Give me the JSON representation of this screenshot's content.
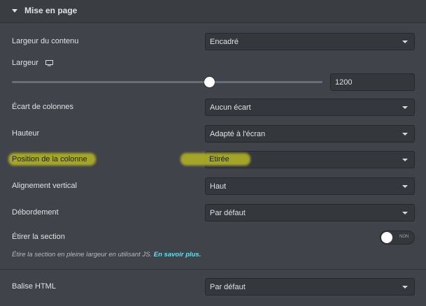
{
  "section": {
    "title": "Mise en page",
    "icon": "caret-down-icon"
  },
  "controls": {
    "content_width": {
      "label": "Largeur du contenu",
      "value": "Encadré"
    },
    "width": {
      "label": "Largeur",
      "icon": "desktop-icon",
      "value": "1200"
    },
    "column_gap": {
      "label": "Écart de colonnes",
      "value": "Aucun écart"
    },
    "height": {
      "label": "Hauteur",
      "value": "Adapté à l'écran"
    },
    "column_position": {
      "label": "Position de la colonne",
      "value": "Etirée"
    },
    "vertical_align": {
      "label": "Alignement vertical",
      "value": "Haut"
    },
    "overflow": {
      "label": "Débordement",
      "value": "Par défaut"
    },
    "stretch_section": {
      "label": "Étirer la section",
      "toggle_text": "NON",
      "help_text": "Étire la section en pleine largeur en utilisant JS.",
      "help_link": "En savoir plus."
    },
    "html_tag": {
      "label": "Balise HTML",
      "value": "Par défaut"
    }
  },
  "colors": {
    "panel_bg": "#404349",
    "input_bg": "#34373c",
    "highlight": "#b7b725",
    "link": "#71d7f7"
  }
}
